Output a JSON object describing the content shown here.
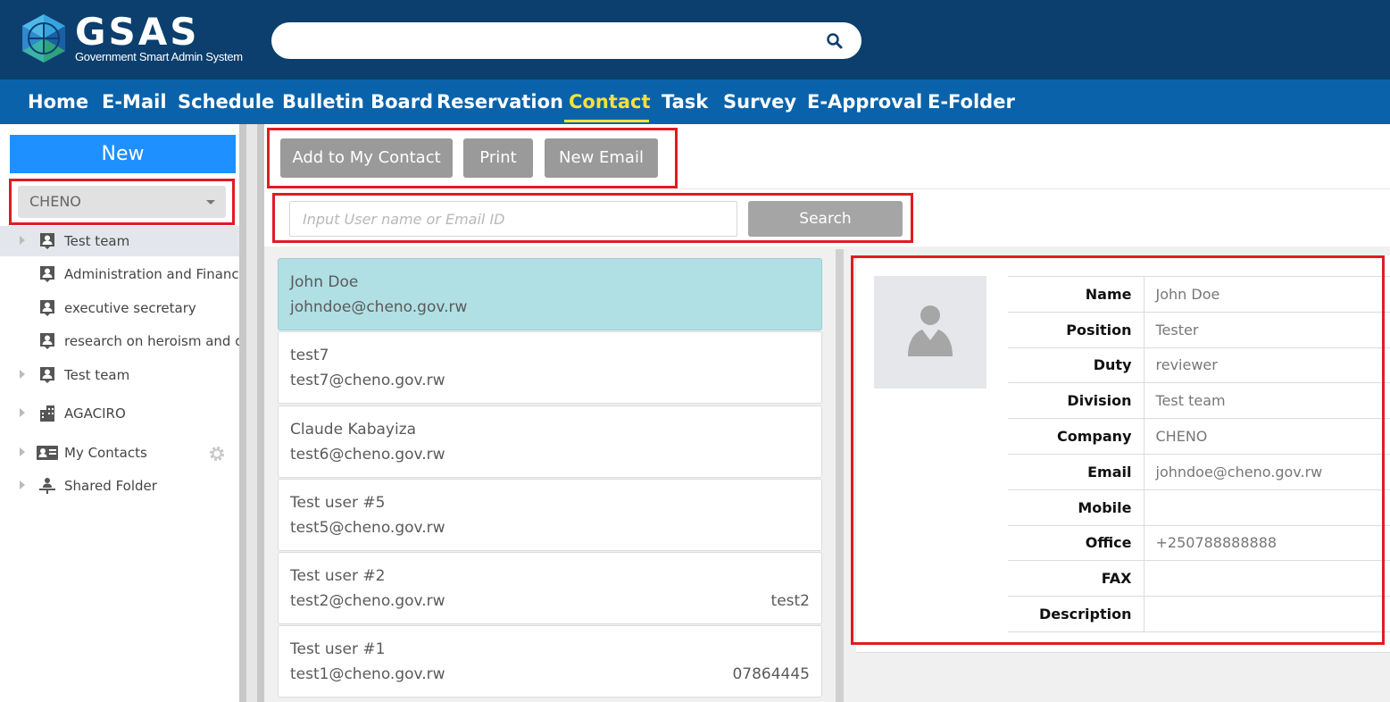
{
  "brand": {
    "name": "GSAS",
    "subtitle": "Government Smart Admin System"
  },
  "header": {
    "search_placeholder": "",
    "search_value": ""
  },
  "nav": {
    "items": [
      "Home",
      "E-Mail",
      "Schedule",
      "Bulletin Board",
      "Reservation",
      "Contact",
      "Task",
      "Survey",
      "E-Approval",
      "E-Folder"
    ],
    "active": "Contact",
    "active_color": "#f6e23a"
  },
  "sidebar": {
    "new_label": "New",
    "company": "CHENO",
    "tree": [
      {
        "label": "Test team",
        "icon": "contact-group-icon",
        "expandable": true,
        "selected": true
      },
      {
        "label": "Administration and Finance",
        "icon": "contact-group-icon",
        "expandable": false
      },
      {
        "label": "executive secretary",
        "icon": "contact-group-icon",
        "expandable": false
      },
      {
        "label": "research on heroism and d",
        "icon": "contact-group-icon",
        "expandable": false
      },
      {
        "label": "Test team",
        "icon": "contact-group-icon",
        "expandable": true
      },
      {
        "label": "AGACIRO",
        "icon": "building-icon",
        "expandable": true
      },
      {
        "label": "My Contacts",
        "icon": "contact-card-icon",
        "expandable": true
      },
      {
        "label": "Shared Folder",
        "icon": "shared-folder-icon",
        "expandable": true
      }
    ]
  },
  "toolbar": {
    "add_label": "Add to My Contact",
    "print_label": "Print",
    "email_label": "New Email"
  },
  "search": {
    "placeholder": "Input User name or Email ID",
    "button_label": "Search"
  },
  "contacts": [
    {
      "name": "John Doe",
      "email": "johndoe@cheno.gov.rw",
      "extra": "",
      "active": true
    },
    {
      "name": "test7",
      "email": "test7@cheno.gov.rw",
      "extra": ""
    },
    {
      "name": "Claude Kabayiza",
      "email": "test6@cheno.gov.rw",
      "extra": ""
    },
    {
      "name": "Test user #5",
      "email": "test5@cheno.gov.rw",
      "extra": ""
    },
    {
      "name": "Test user #2",
      "email": "test2@cheno.gov.rw",
      "extra": "test2"
    },
    {
      "name": "Test user #1",
      "email": "test1@cheno.gov.rw",
      "extra": "07864445"
    }
  ],
  "detail": {
    "fields": [
      {
        "label": "Name",
        "value": "John Doe"
      },
      {
        "label": "Position",
        "value": "Tester"
      },
      {
        "label": "Duty",
        "value": "reviewer"
      },
      {
        "label": "Division",
        "value": "Test team"
      },
      {
        "label": "Company",
        "value": "CHENO"
      },
      {
        "label": "Email",
        "value": "johndoe@cheno.gov.rw"
      },
      {
        "label": "Mobile",
        "value": ""
      },
      {
        "label": "Office",
        "value": "+250788888888"
      },
      {
        "label": "FAX",
        "value": ""
      },
      {
        "label": "Description",
        "value": ""
      }
    ]
  },
  "colors": {
    "header": "#0c3f6e",
    "nav": "#0a63aa",
    "new_button": "#1e90ff",
    "highlight_box": "#e01b24",
    "active_contact": "#b0dfe4"
  }
}
